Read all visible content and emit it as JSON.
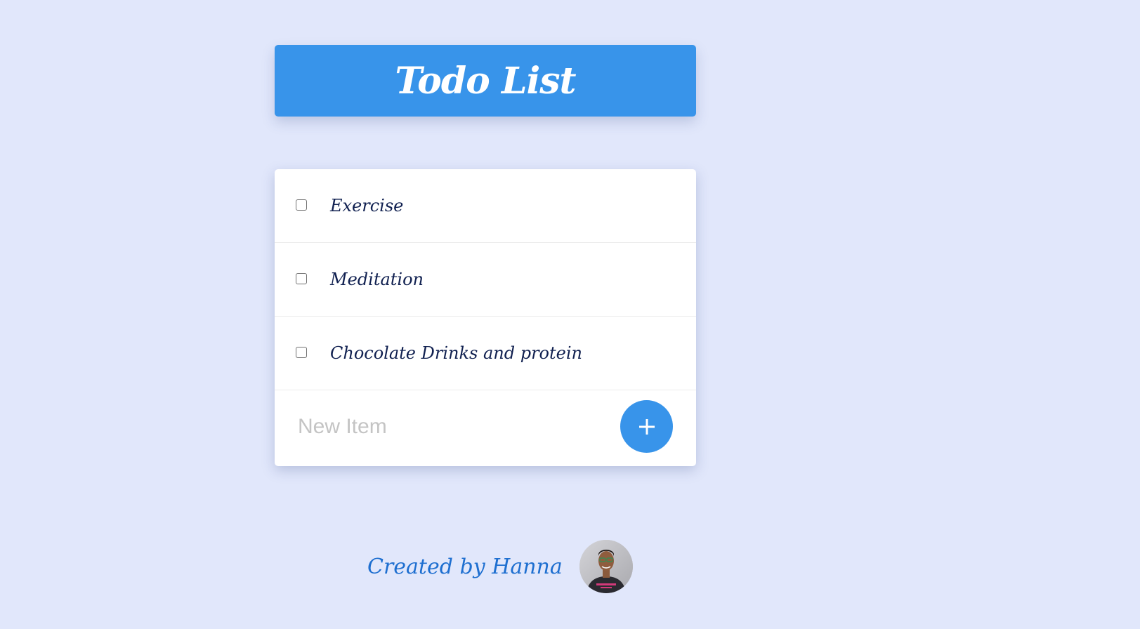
{
  "header": {
    "title": "Todo List"
  },
  "todo": {
    "items": [
      {
        "label": "Exercise",
        "checked": false
      },
      {
        "label": "Meditation",
        "checked": false
      },
      {
        "label": "Chocolate Drinks and protein",
        "checked": false
      }
    ],
    "new_item": {
      "placeholder": "New Item",
      "value": ""
    },
    "add_button": {
      "label": "+",
      "icon": "plus-icon"
    }
  },
  "footer": {
    "created_by": "Created by  Hanna",
    "avatar_icon": "avatar"
  },
  "colors": {
    "background": "#e1e7fb",
    "accent": "#3894ea",
    "item_text": "#102050",
    "footer_text": "#1e6fd0"
  }
}
